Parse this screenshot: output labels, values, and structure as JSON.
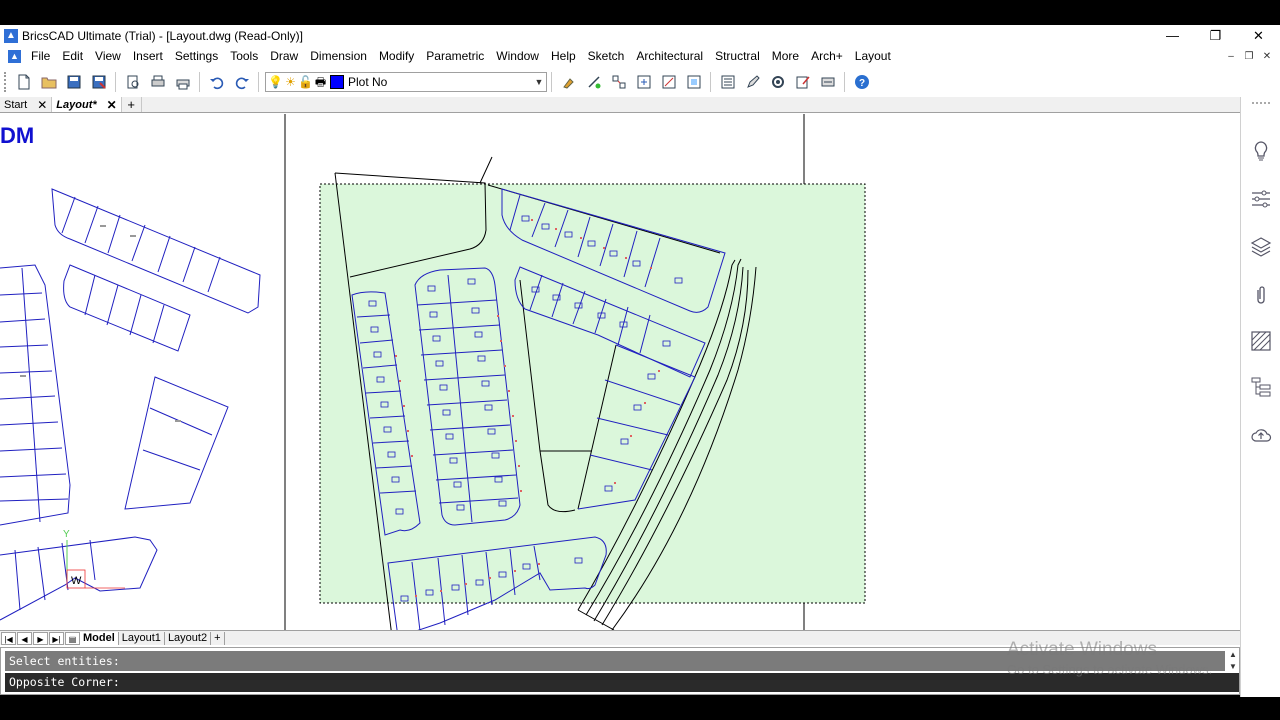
{
  "window": {
    "title": "BricsCAD Ultimate (Trial) - [Layout.dwg (Read-Only)]",
    "controls": [
      "—",
      "❐",
      "✕"
    ]
  },
  "menu": [
    "File",
    "Edit",
    "View",
    "Insert",
    "Settings",
    "Tools",
    "Draw",
    "Dimension",
    "Modify",
    "Parametric",
    "Window",
    "Help",
    "Sketch",
    "Architectural",
    "Structral",
    "More",
    "Arch+",
    "Layout"
  ],
  "mdi_controls": [
    "–",
    "❐",
    "✕"
  ],
  "toolbar": {
    "layer_name": "Plot No",
    "layer_color": "#0000ff"
  },
  "doc_tabs": {
    "start": "Start",
    "layout": "Layout*",
    "add": "+"
  },
  "canvas": {
    "partial_text": "DM",
    "ucs_label": "Y",
    "ucs_w": "W"
  },
  "layout_tabs": {
    "nav": [
      "|◀",
      "◀",
      "▶",
      "▶|",
      "▤"
    ],
    "tabs": [
      "Model",
      "Layout1",
      "Layout2"
    ],
    "add": "+"
  },
  "command": {
    "history": "Select entities:",
    "prompt": "Opposite Corner:"
  },
  "watermark": {
    "line1": "Activate Windows",
    "line2": "Go to Settings to activate Windows."
  }
}
